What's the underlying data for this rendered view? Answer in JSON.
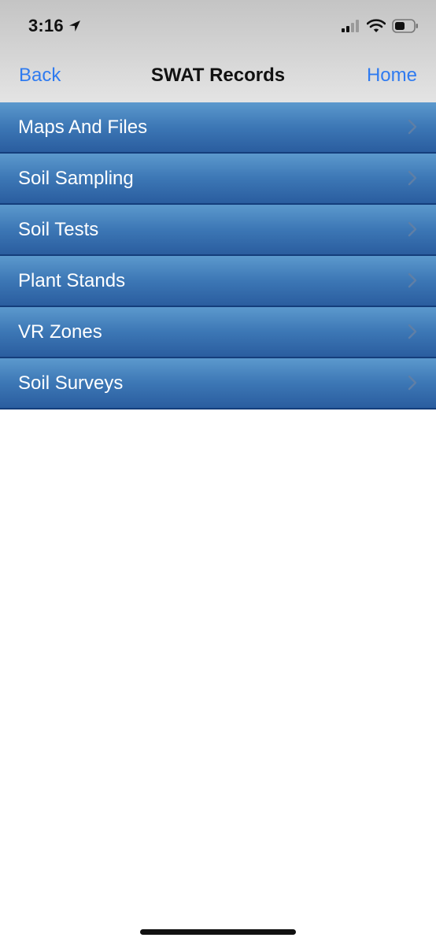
{
  "status_bar": {
    "time": "3:16",
    "icons": [
      "location-arrow-icon",
      "cellular-signal-icon",
      "wifi-icon",
      "battery-icon"
    ]
  },
  "nav": {
    "back_label": "Back",
    "title": "SWAT Records",
    "home_label": "Home"
  },
  "menu": {
    "items": [
      {
        "label": "Maps And Files"
      },
      {
        "label": "Soil Sampling"
      },
      {
        "label": "Soil Tests"
      },
      {
        "label": "Plant Stands"
      },
      {
        "label": "VR Zones"
      },
      {
        "label": "Soil Surveys"
      }
    ]
  },
  "colors": {
    "accent": "#2f7bf0",
    "row_top": "#5c99cd",
    "row_bottom": "#2a5d9f",
    "row_text": "#ffffff",
    "nav_bar": "#d2d2d2"
  }
}
